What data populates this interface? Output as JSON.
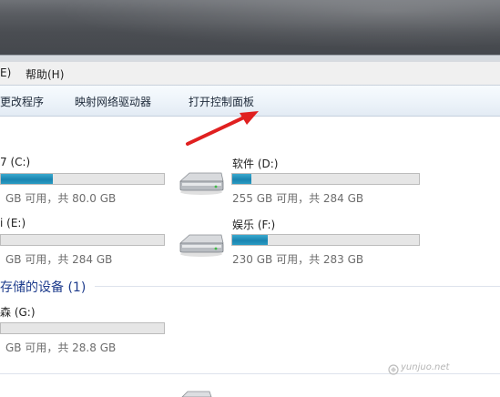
{
  "menu": {
    "partial_item": "E)",
    "help": "帮助(H)"
  },
  "toolbar": {
    "change_program": "更改程序",
    "map_drive": "映射网络驱动器",
    "open_control_panel": "打开控制面板"
  },
  "drives": [
    {
      "name": "7 (C:)",
      "free": "GB 可用，共 80.0 GB",
      "fill_fraction": 0.32
    },
    {
      "name": "软件 (D:)",
      "free": "255 GB 可用，共 284 GB",
      "fill_fraction": 0.1
    },
    {
      "name": "i (E:)",
      "free": "GB 可用，共 284 GB",
      "fill_fraction": 0.0
    },
    {
      "name": "娱乐 (F:)",
      "free": "230 GB 可用，共 283 GB",
      "fill_fraction": 0.19
    }
  ],
  "removable": {
    "section_title": "存储的设备 (1)",
    "name": "森 (G:)",
    "free": "GB 可用，共 28.8 GB",
    "fill_fraction": 0.0
  },
  "watermark": "yunjuo.net",
  "colors": {
    "bar_fill": "#1a84b0",
    "section_title": "#1e3c8c",
    "arrow": "#e02020"
  }
}
